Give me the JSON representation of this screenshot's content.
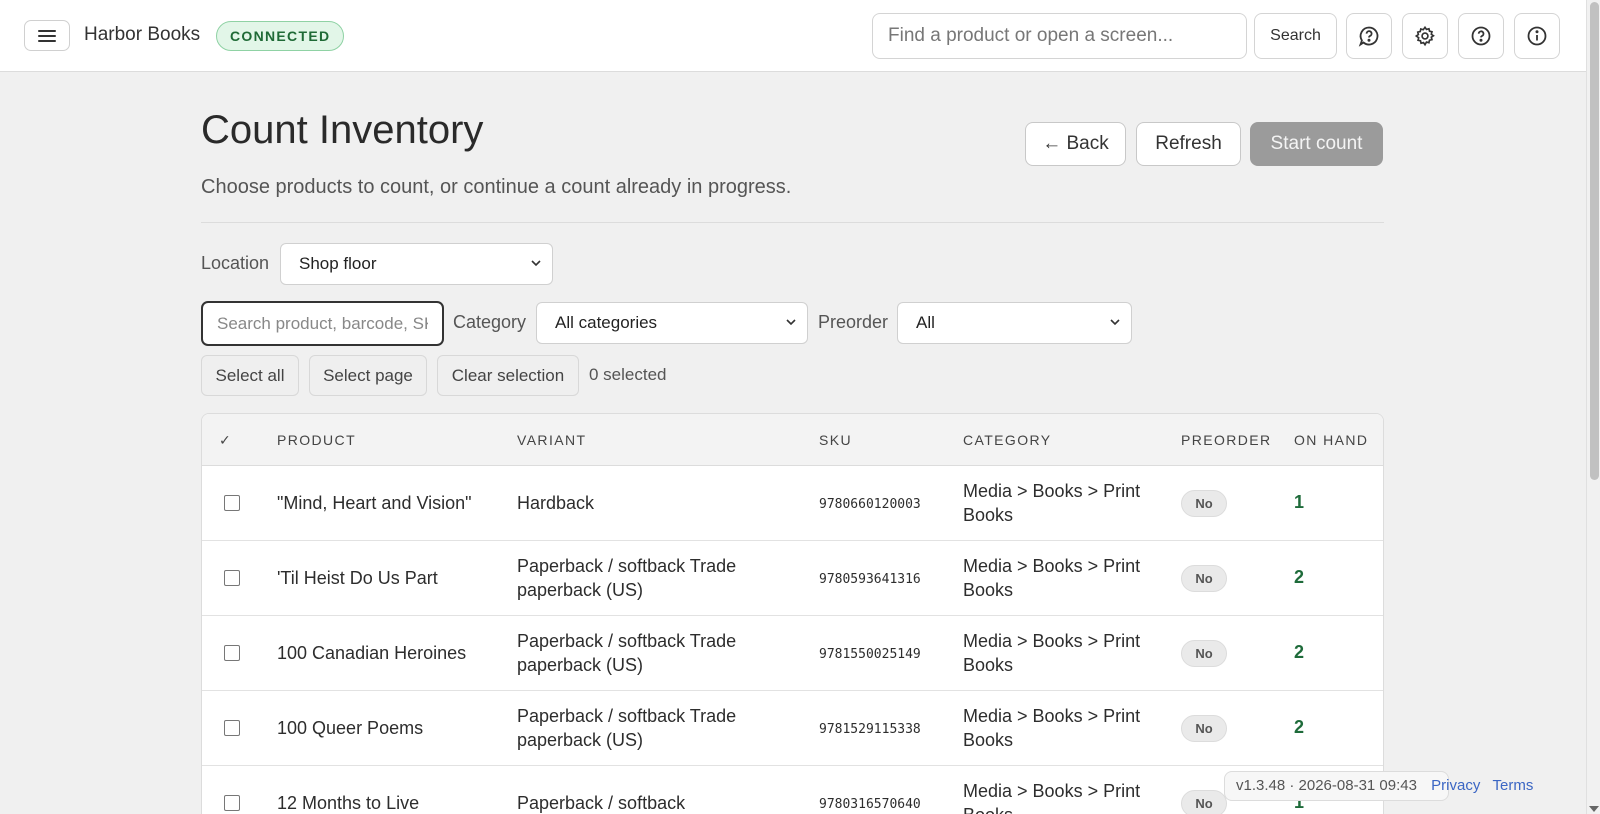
{
  "topbar": {
    "brand": "Harbor Books",
    "status_badge": "CONNECTED",
    "search_placeholder": "Find a product or open a screen...",
    "search_button": "Search"
  },
  "page": {
    "title": "Count Inventory",
    "subtitle": "Choose products to count, or continue a count already in progress.",
    "back_button": "← Back",
    "refresh_button": "Refresh",
    "start_count_button": "Start count"
  },
  "filters": {
    "location_label": "Location",
    "location_value": "Shop floor",
    "search_placeholder": "Search product, barcode, SKU",
    "category_label": "Category",
    "category_value": "All categories",
    "preorder_label": "Preorder",
    "preorder_value": "All"
  },
  "selection": {
    "select_all": "Select all",
    "select_page": "Select page",
    "clear_selection": "Clear selection",
    "count_text": "0 selected"
  },
  "table": {
    "headers": {
      "check": "✓",
      "product": "PRODUCT",
      "variant": "VARIANT",
      "sku": "SKU",
      "category": "CATEGORY",
      "preorder": "PREORDER",
      "on_hand": "ON HAND"
    },
    "rows": [
      {
        "product": "\"Mind, Heart and Vision\"",
        "variant": "Hardback",
        "sku": "9780660120003",
        "category": "Media > Books > Print Books",
        "preorder": "No",
        "on_hand": "1"
      },
      {
        "product": "'Til Heist Do Us Part",
        "variant": "Paperback / softback Trade paperback (US)",
        "sku": "9780593641316",
        "category": "Media > Books > Print Books",
        "preorder": "No",
        "on_hand": "2"
      },
      {
        "product": "100 Canadian Heroines",
        "variant": "Paperback / softback Trade paperback (US)",
        "sku": "9781550025149",
        "category": "Media > Books > Print Books",
        "preorder": "No",
        "on_hand": "2"
      },
      {
        "product": "100 Queer Poems",
        "variant": "Paperback / softback Trade paperback (US)",
        "sku": "9781529115338",
        "category": "Media > Books > Print Books",
        "preorder": "No",
        "on_hand": "2"
      },
      {
        "product": "12 Months to Live",
        "variant": "Paperback / softback",
        "sku": "9780316570640",
        "category": "Media > Books > Print Books",
        "preorder": "No",
        "on_hand": "1"
      }
    ]
  },
  "footer": {
    "version": "v1.3.48 · 2026-08-31 09:43",
    "privacy": "Privacy",
    "terms": "Terms"
  }
}
